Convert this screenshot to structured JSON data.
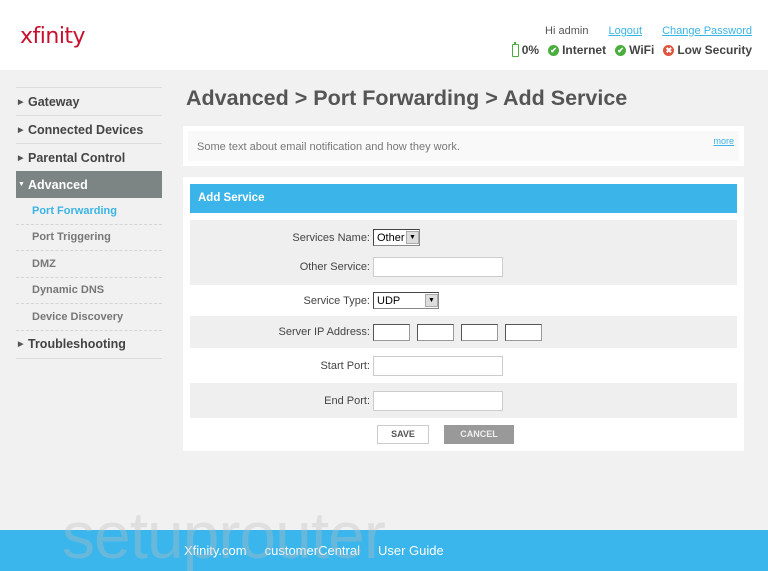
{
  "header": {
    "logo": "xfinity",
    "greeting": "Hi admin",
    "logout_label": "Logout",
    "change_password_label": "Change Password",
    "status": {
      "battery": "0%",
      "internet": "Internet",
      "wifi": "WiFi",
      "security": "Low Security"
    }
  },
  "sidebar": {
    "items": [
      {
        "label": "Gateway",
        "expanded": false
      },
      {
        "label": "Connected Devices",
        "expanded": false
      },
      {
        "label": "Parental Control",
        "expanded": false
      },
      {
        "label": "Advanced",
        "expanded": true
      },
      {
        "label": "Troubleshooting",
        "expanded": false
      }
    ],
    "subitems": [
      {
        "label": "Port Forwarding",
        "current": true
      },
      {
        "label": "Port Triggering"
      },
      {
        "label": "DMZ"
      },
      {
        "label": "Dynamic DNS"
      },
      {
        "label": "Device Discovery"
      }
    ]
  },
  "main": {
    "title": "Advanced > Port Forwarding > Add Service",
    "info_text": "Some text about email notification and how they work.",
    "more_label": "more",
    "form": {
      "header": "Add Service",
      "services_name_label": "Services Name:",
      "services_name_value": "Other",
      "other_service_label": "Other Service:",
      "other_service_value": "",
      "service_type_label": "Service Type:",
      "service_type_value": "UDP",
      "server_ip_label": "Server IP Address:",
      "server_ip_values": [
        "",
        "",
        "",
        ""
      ],
      "start_port_label": "Start Port:",
      "start_port_value": "",
      "end_port_label": "End Port:",
      "end_port_value": "",
      "save_label": "SAVE",
      "cancel_label": "CANCEL"
    }
  },
  "footer": {
    "links": [
      "Xfinity.com",
      "customerCentral",
      "User Guide"
    ],
    "watermark": "setuprouter"
  },
  "colors": {
    "brand_red": "#c8102e",
    "accent_blue": "#3ab4e9",
    "ok_green": "#4aad3d",
    "alert_red": "#e0533a"
  }
}
